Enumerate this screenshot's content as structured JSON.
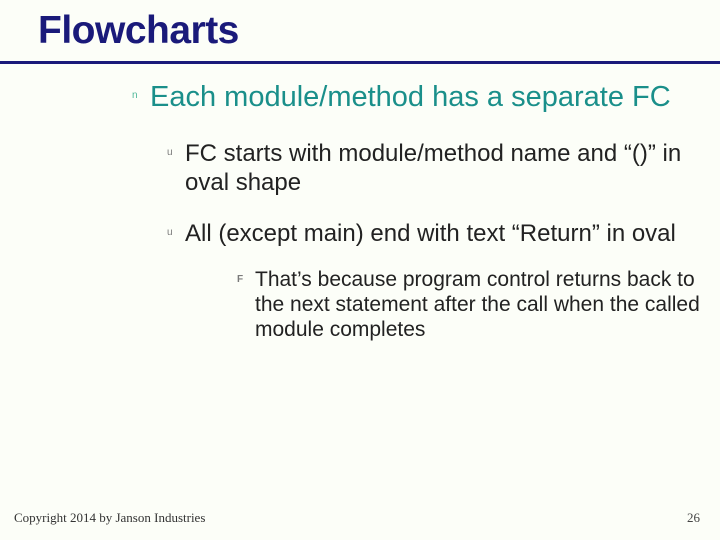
{
  "slide": {
    "title": "Flowcharts",
    "lvl1": {
      "text": "Each module/method has a separate FC"
    },
    "lvl2a": {
      "text": "FC starts with module/method name and “()” in oval shape"
    },
    "lvl2b": {
      "text": "All (except main) end with text “Return” in oval"
    },
    "lvl3": {
      "text": "That’s because program control returns back to the next statement after the call when the called module completes"
    }
  },
  "footer": {
    "copyright": "Copyright 2014 by Janson Industries",
    "page": "26"
  },
  "bullets": {
    "n": "n",
    "u": "u",
    "F": "F"
  }
}
